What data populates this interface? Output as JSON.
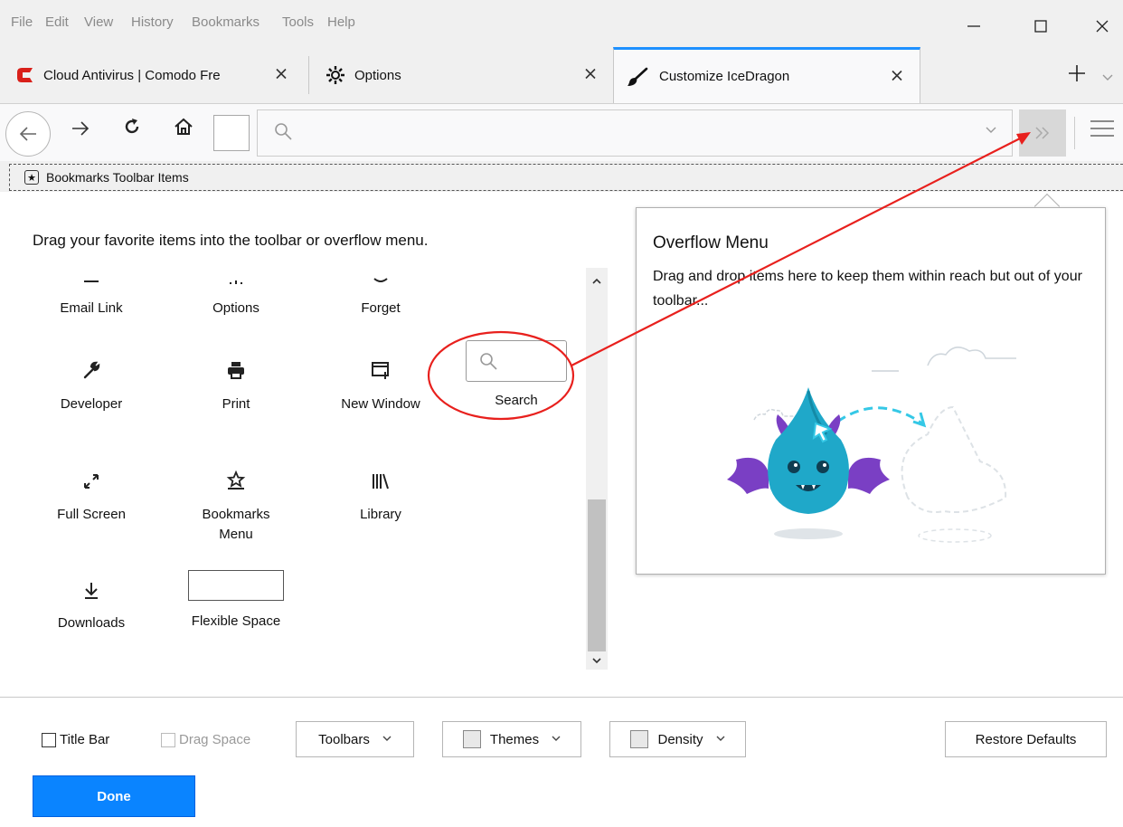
{
  "menu": [
    {
      "label": "File"
    },
    {
      "label": "Edit"
    },
    {
      "label": "View"
    },
    {
      "label": "History"
    },
    {
      "label": "Bookmarks"
    },
    {
      "label": "Tools"
    },
    {
      "label": "Help"
    }
  ],
  "window_controls": {
    "minimize": "—",
    "maximize": "☐",
    "close": "✕"
  },
  "tabs": [
    {
      "label": "Cloud Antivirus | Comodo Fre",
      "icon": "comodo-logo-icon",
      "active": false
    },
    {
      "label": "Options",
      "icon": "gear-icon",
      "active": false
    },
    {
      "label": "Customize IceDragon",
      "icon": "brush-icon",
      "active": true
    }
  ],
  "tab_controls": {
    "new_tab": "+",
    "list_all": "⌄",
    "close": "✕"
  },
  "navbar": {
    "back": "←",
    "forward": "→",
    "reload": "C",
    "home": "⌂",
    "url_dropdown": "⌄",
    "overflow": "»"
  },
  "bookmarks_toolbar": {
    "label": "Bookmarks Toolbar Items"
  },
  "customize": {
    "instructions": "Drag your favorite items into the toolbar or overflow menu."
  },
  "palette": [
    {
      "label": "Email Link",
      "icon": "email-link-icon"
    },
    {
      "label": "Options",
      "icon": "gear-icon"
    },
    {
      "label": "Forget",
      "icon": "forget-icon"
    },
    {
      "label": "Developer",
      "icon": "wrench-icon"
    },
    {
      "label": "Print",
      "icon": "printer-icon"
    },
    {
      "label": "New Window",
      "icon": "new-window-icon"
    },
    {
      "label": "Search",
      "icon": "search-icon"
    },
    {
      "label": "Full Screen",
      "icon": "fullscreen-icon"
    },
    {
      "label": "Bookmarks Menu",
      "icon": "bookmarks-menu-icon"
    },
    {
      "label": "Library",
      "icon": "library-icon"
    },
    {
      "label": "Downloads",
      "icon": "download-icon"
    },
    {
      "label": "Flexible Space",
      "icon": "flexible-space-box"
    }
  ],
  "scrollbar": {
    "up": "^",
    "down": "v"
  },
  "overflow_menu": {
    "title": "Overflow Menu",
    "description": "Drag and drop items here to keep them within reach but out of your toolbar..."
  },
  "footer": {
    "title_bar": "Title Bar",
    "drag_space": "Drag Space",
    "toolbars": "Toolbars",
    "themes": "Themes",
    "density": "Density",
    "caret": "⌄",
    "restore_defaults": "Restore Defaults",
    "done": "Done"
  },
  "colors": {
    "accent": "#0a84ff",
    "active_tab_border": "#1e90ff",
    "annotation": "#e8201d",
    "comodo": "#d9201a",
    "dragon_body": "#1fa8c9",
    "dragon_wings": "#7a3fc4",
    "dashed_cyan": "#35c8e6"
  }
}
